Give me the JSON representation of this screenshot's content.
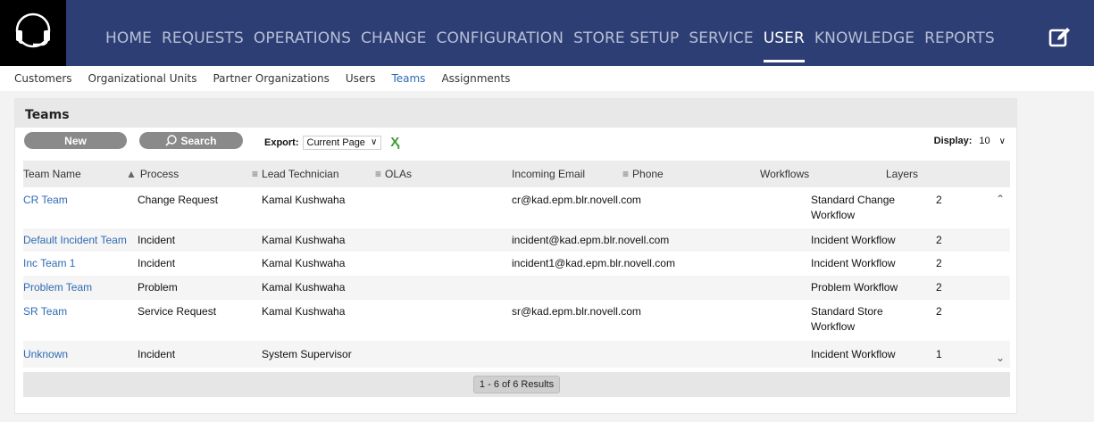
{
  "nav": {
    "items": [
      "HOME",
      "REQUESTS",
      "OPERATIONS",
      "CHANGE",
      "CONFIGURATION",
      "STORE SETUP",
      "SERVICE",
      "USER",
      "KNOWLEDGE",
      "REPORTS"
    ],
    "active": "USER"
  },
  "subnav": {
    "items": [
      "Customers",
      "Organizational Units",
      "Partner Organizations",
      "Users",
      "Teams",
      "Assignments"
    ],
    "active": "Teams"
  },
  "panel": {
    "title": "Teams",
    "new_label": "New",
    "search_label": "Search",
    "export_label": "Export:",
    "export_value": "Current Page",
    "display_label": "Display:",
    "display_value": "10"
  },
  "table": {
    "headers": {
      "team_name": "Team Name",
      "process": "Process",
      "lead": "Lead Technician",
      "olas": "OLAs",
      "email": "Incoming Email",
      "phone": "Phone",
      "workflows": "Workflows",
      "layers": "Layers"
    },
    "rows": [
      {
        "team": "CR Team",
        "process": "Change Request",
        "lead": "Kamal Kushwaha",
        "email": "cr@kad.epm.blr.novell.com",
        "workflow": "Standard Change Workflow",
        "layers": "2"
      },
      {
        "team": "Default Incident Team",
        "process": "Incident",
        "lead": "Kamal Kushwaha",
        "email": "incident@kad.epm.blr.novell.com",
        "workflow": "Incident Workflow",
        "layers": "2"
      },
      {
        "team": "Inc Team 1",
        "process": "Incident",
        "lead": "Kamal Kushwaha",
        "email": "incident1@kad.epm.blr.novell.com",
        "workflow": "Incident Workflow",
        "layers": "2"
      },
      {
        "team": "Problem Team",
        "process": "Problem",
        "lead": "Kamal Kushwaha",
        "email": "",
        "workflow": "Problem Workflow",
        "layers": "2"
      },
      {
        "team": "SR Team",
        "process": "Service Request",
        "lead": "Kamal Kushwaha",
        "email": "sr@kad.epm.blr.novell.com",
        "workflow": "Standard Store Workflow",
        "layers": "2"
      },
      {
        "team": "Unknown",
        "process": "Incident",
        "lead": "System Supervisor",
        "email": "",
        "workflow": "Incident Workflow",
        "layers": "1"
      }
    ],
    "results": "1 - 6 of 6 Results"
  },
  "colors": {
    "topbar": "#2d3e74",
    "link": "#2f6ab3",
    "button": "#8a8a8a"
  },
  "icons": [
    "headset-logo-icon",
    "edit-icon",
    "search-icon",
    "excel-export-icon",
    "sort-ascending-icon",
    "column-menu-icon",
    "scroll-up-icon",
    "scroll-down-icon"
  ]
}
